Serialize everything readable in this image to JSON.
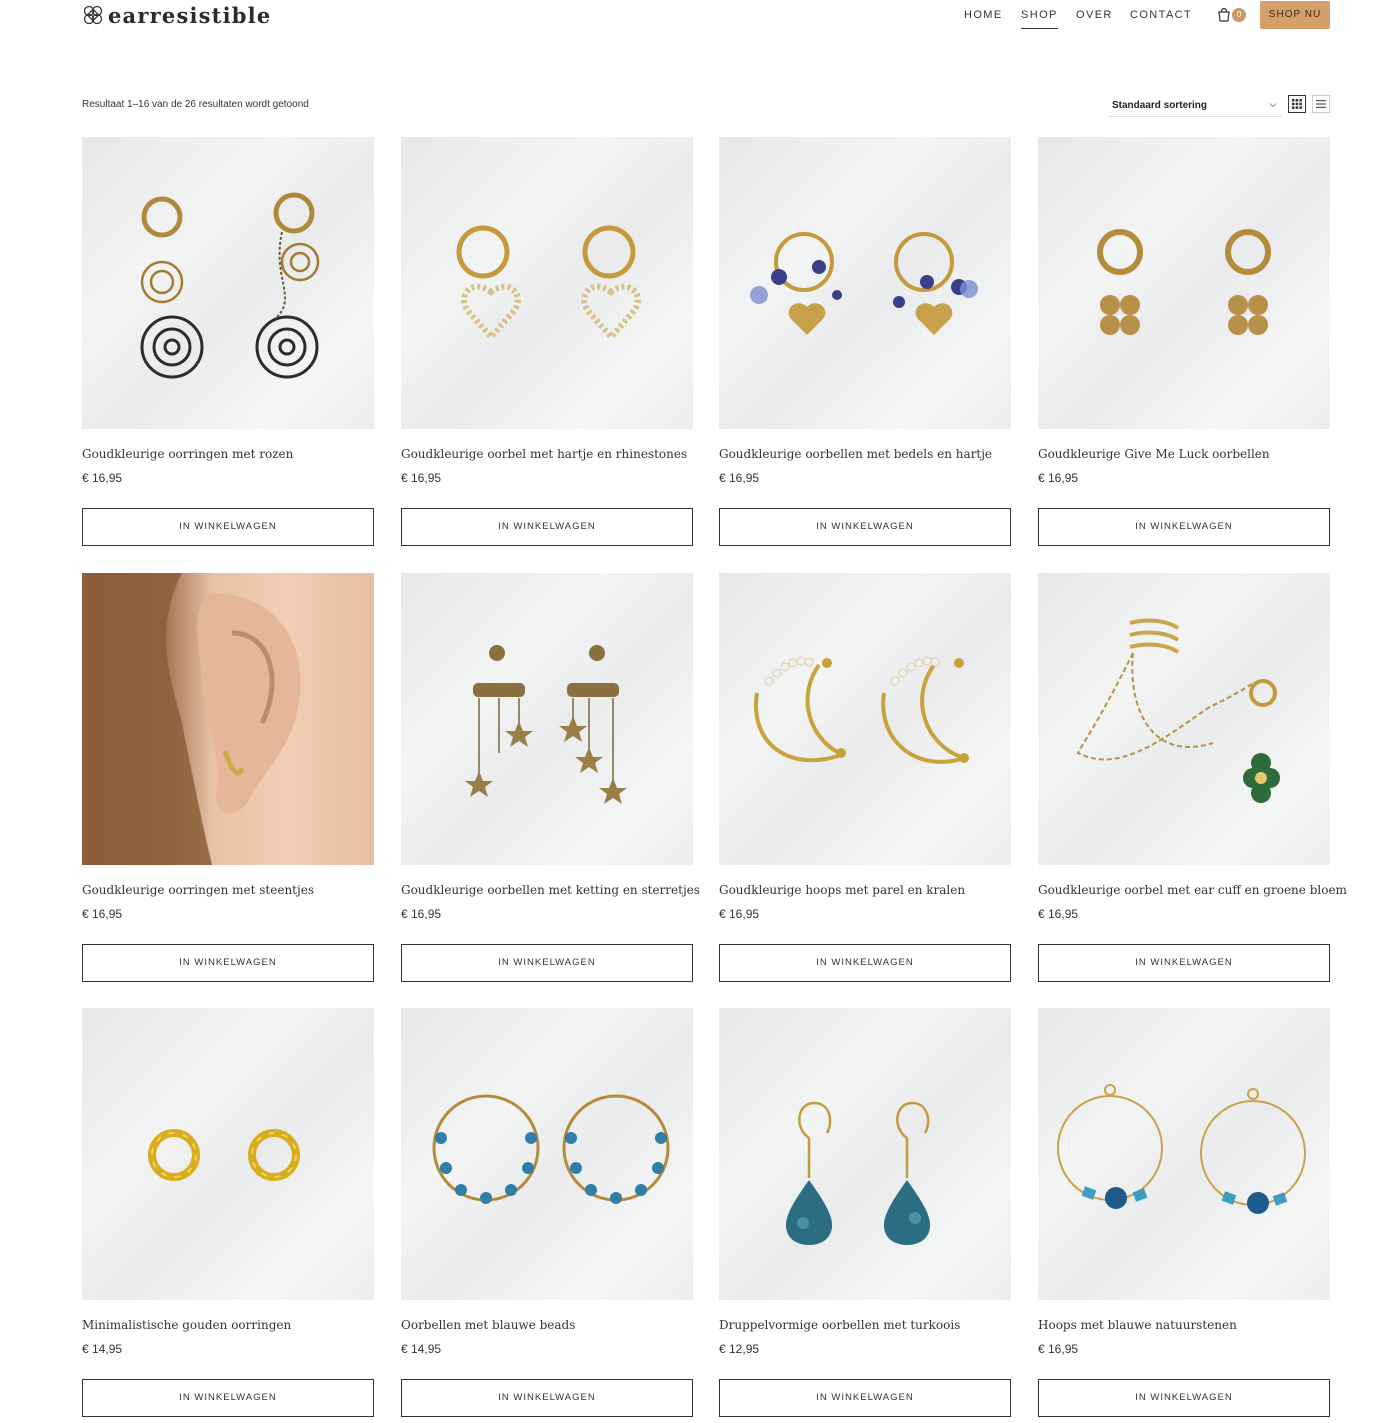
{
  "header": {
    "logo_text": "earresistible",
    "nav": [
      "HOME",
      "SHOP",
      "OVER",
      "CONTACT"
    ],
    "active_nav": "SHOP",
    "cart_count": "0",
    "shop_button": "SHOP NU"
  },
  "toolbar": {
    "result_count": "Resultaat 1–16 van de 26 resultaten wordt getoond",
    "sort_selected": "Standaard sortering"
  },
  "products": [
    {
      "title": "Goudkleurige oorringen met rozen",
      "price": "€ 16,95",
      "button": "IN WINKELWAGEN",
      "image": "gold-hoops-rose-charms"
    },
    {
      "title": "Goudkleurige oorbel met hartje en rhinestones",
      "price": "€ 16,95",
      "button": "IN WINKELWAGEN",
      "image": "gold-hoops-rhinestone-heart"
    },
    {
      "title": "Goudkleurige oorbellen met bedels en hartje",
      "price": "€ 16,95",
      "button": "IN WINKELWAGEN",
      "image": "gold-hoops-blue-beads-heart"
    },
    {
      "title": "Goudkleurige Give Me Luck oorbellen",
      "price": "€ 16,95",
      "button": "IN WINKELWAGEN",
      "image": "gold-hoops-clover"
    },
    {
      "title": "Goudkleurige oorringen met steentjes",
      "price": "€ 16,95",
      "button": "IN WINKELWAGEN",
      "image": "ear-model-huggie"
    },
    {
      "title": "Goudkleurige oorbellen met ketting en sterretjes",
      "price": "€ 16,95",
      "button": "IN WINKELWAGEN",
      "image": "gold-chain-stars"
    },
    {
      "title": "Goudkleurige hoops met parel en kralen",
      "price": "€ 16,95",
      "button": "IN WINKELWAGEN",
      "image": "gold-half-hoops-pearls"
    },
    {
      "title": "Goudkleurige oorbel met ear cuff en groene bloem",
      "price": "€ 16,95",
      "button": "IN WINKELWAGEN",
      "image": "gold-ear-cuff-green-flower"
    },
    {
      "title": "Minimalistische gouden oorringen",
      "price": "€ 14,95",
      "button": "IN WINKELWAGEN",
      "image": "gold-twisted-huggies"
    },
    {
      "title": "Oorbellen met blauwe beads",
      "price": "€ 14,95",
      "button": "IN WINKELWAGEN",
      "image": "gold-hoops-blue-beads"
    },
    {
      "title": "Druppelvormige oorbellen met turkoois",
      "price": "€ 12,95",
      "button": "IN WINKELWAGEN",
      "image": "turquoise-drop-earrings"
    },
    {
      "title": "Hoops met blauwe natuurstenen",
      "price": "€ 16,95",
      "button": "IN WINKELWAGEN",
      "image": "gold-hoops-blue-stones"
    }
  ],
  "colors": {
    "accent": "#d4a06a",
    "text": "#333333",
    "gold": "#c9a24a",
    "blue": "#2a6fa0"
  },
  "icons": {
    "cart": "shopping-bag-icon",
    "grid_view": "grid-view-icon",
    "list_view": "list-view-icon",
    "sort": "chevron-down-icon"
  }
}
